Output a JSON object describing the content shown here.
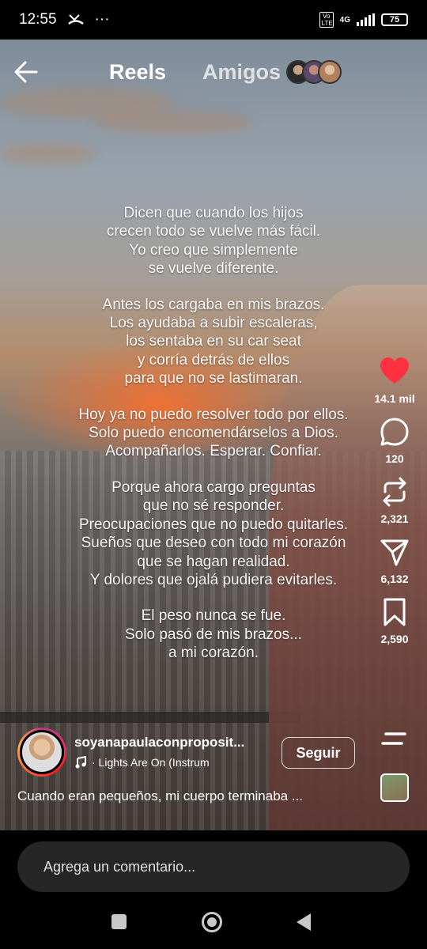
{
  "status_bar": {
    "time": "12:55",
    "more": "···",
    "volte": "Vo LTE",
    "network": "4G",
    "battery": "75"
  },
  "header": {
    "tab_reels": "Reels",
    "tab_amigos": "Amigos",
    "friend_avatar_count": 3
  },
  "overlay_text": {
    "stanzas": [
      [
        "Dicen que cuando los hijos",
        "crecen todo se vuelve más fácil.",
        "Yo creo que simplemente",
        "se vuelve diferente."
      ],
      [
        "Antes los cargaba en mis brazos.",
        "Los ayudaba a subir escaleras,",
        "los sentaba en su car seat",
        "y corría detrás de ellos",
        "para que no se lastimaran."
      ],
      [
        "Hoy ya no puedo resolver todo por ellos.",
        "Solo puedo encomendárselos a Dios.",
        "Acompañarlos. Esperar. Confiar."
      ],
      [
        "Porque ahora cargo preguntas",
        "que no sé responder.",
        "Preocupaciones que no puedo quitarles.",
        "Sueños que deseo con todo mi corazón",
        "que se hagan realidad.",
        "Y dolores que ojalá pudiera evitarles."
      ],
      [
        "El peso nunca se fue.",
        "Solo pasó de mis brazos...",
        "a mi corazón."
      ]
    ]
  },
  "actions": {
    "likes": "14.1 mil",
    "comments": "120",
    "reposts": "2,321",
    "shares": "6,132",
    "saves": "2,590",
    "like_color": "#ff3040"
  },
  "author": {
    "username": "soyanapaulaconproposit...",
    "music": "· Lights Are On (Instrum",
    "follow_label": "Seguir",
    "caption": "Cuando eran pequeños, mi cuerpo terminaba ..."
  },
  "comment_bar": {
    "placeholder": "Agrega un comentario..."
  },
  "icons": {
    "back": "arrow-left-icon",
    "like": "heart-icon",
    "comment": "speech-bubble-icon",
    "repost": "repost-icon",
    "share": "paper-plane-icon",
    "save": "bookmark-icon",
    "menu": "menu-icon"
  }
}
